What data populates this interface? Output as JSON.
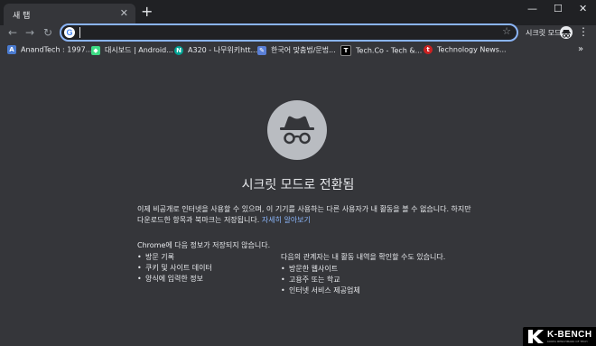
{
  "tab": {
    "title": "새 탭",
    "close": "✕"
  },
  "new_tab": "+",
  "window": {
    "minimize": "—",
    "maximize": "☐",
    "close": "✕"
  },
  "toolbar": {
    "back": "←",
    "forward": "→",
    "reload": "↻",
    "omnibox_value": "",
    "google_icon": "G",
    "star": "☆",
    "incognito_label": "시크릿 모드",
    "menu": "⋮"
  },
  "bookmarks": {
    "items": [
      {
        "label": "AnandTech : 1997...",
        "icon": "anandtech-icon",
        "glyph": "A",
        "color": "#4a7bd0"
      },
      {
        "label": "대시보드 | Android...",
        "icon": "android-icon",
        "glyph": "◆",
        "color": "#3ddc84"
      },
      {
        "label": "A320 - 나무위키htt...",
        "icon": "namuwiki-icon",
        "glyph": "N",
        "color": "#00a495"
      },
      {
        "label": "한국어 맞춤법/문법...",
        "icon": "pencil-icon",
        "glyph": "✎",
        "color": "#5a7fd6"
      },
      {
        "label": "Tech.Co - Tech &...",
        "icon": "techco-icon",
        "glyph": "T",
        "color": "#000000"
      },
      {
        "label": "Technology News...",
        "icon": "technews-icon",
        "glyph": "t",
        "color": "#cc2222"
      }
    ],
    "more": "»"
  },
  "content": {
    "heading": "시크릿 모드로 전환됨",
    "paragraph": "이제 비공개로 인터넷을 사용할 수 있으며, 이 기기를 사용하는 다른 사용자가 내 활동을 볼 수 없습니다. 하지만 다운로드한 항목과 북마크는 저장됩니다.",
    "learn_more": "자세히 알아보기",
    "not_saved_heading": "Chrome에 다음 정보가 저장되지 않습니다.",
    "not_saved": [
      "방문 기록",
      "쿠키 및 사이트 데이터",
      "양식에 입력한 정보"
    ],
    "visible_heading": "다음의 관계자는 내 활동 내역을 확인할 수도 있습니다.",
    "visible_to": [
      "방문한 웹사이트",
      "고용주 또는 학교",
      "인터넷 서비스 제공업체"
    ],
    "bullet": "•"
  },
  "watermark": {
    "text": "K-BENCH",
    "small": "KOREA BENCHMARK OF TECH"
  },
  "colors": {
    "background": "#35363a",
    "tabbar": "#202124",
    "accent": "#8ab4f8",
    "incognito_circle": "#b9bcc1"
  }
}
